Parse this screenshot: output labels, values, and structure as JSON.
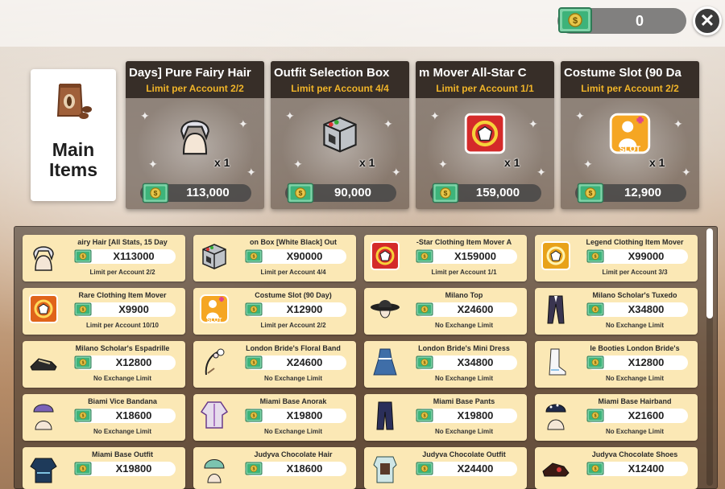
{
  "currency": {
    "amount": "0",
    "icon": "cash-icon"
  },
  "close": {
    "label": "✕"
  },
  "main_tab": {
    "label_line1": "Main",
    "label_line2": "Items",
    "icon": "coffee-bag-icon"
  },
  "featured": [
    {
      "title": "Days] Pure Fairy Hair",
      "limit": "Limit per Account 2/2",
      "qty": "x 1",
      "price": "113,000",
      "icon": "hair-icon"
    },
    {
      "title": "Outfit Selection Box",
      "limit": "Limit per Account 4/4",
      "qty": "x 1",
      "price": "90,000",
      "icon": "box-icon"
    },
    {
      "title": "m Mover      All-Star C",
      "limit": "Limit per Account 1/1",
      "qty": "x 1",
      "price": "159,000",
      "icon": "mover-icon"
    },
    {
      "title": "Costume Slot (90 Da",
      "limit": "Limit per Account 2/2",
      "qty": "x 1",
      "price": "12,900",
      "icon": "slot-icon"
    }
  ],
  "grid": [
    {
      "name": "airy Hair        [All Stats, 15 Day",
      "price": "X113000",
      "limit": "Limit per Account 2/2",
      "icon": "hair-icon"
    },
    {
      "name": "on Box        [White Black] Out",
      "price": "X90000",
      "limit": "Limit per Account 4/4",
      "icon": "box-icon"
    },
    {
      "name": "-Star Clothing Item Mover       A",
      "price": "X159000",
      "limit": "Limit per Account 1/1",
      "icon": "mover-icon"
    },
    {
      "name": "Legend Clothing Item Mover",
      "price": "X99000",
      "limit": "Limit per Account 3/3",
      "icon": "legend-mover-icon"
    },
    {
      "name": "Rare Clothing Item Mover",
      "price": "X9900",
      "limit": "Limit per Account 10/10",
      "icon": "rare-mover-icon"
    },
    {
      "name": "Costume Slot (90 Day)",
      "price": "X12900",
      "limit": "Limit per Account 2/2",
      "icon": "slot-icon"
    },
    {
      "name": "Milano Top",
      "price": "X24600",
      "limit": "No Exchange Limit",
      "icon": "hat-icon"
    },
    {
      "name": "Milano Scholar's Tuxedo",
      "price": "X34800",
      "limit": "No Exchange Limit",
      "icon": "tuxedo-icon"
    },
    {
      "name": "Milano Scholar's Espadrille",
      "price": "X12800",
      "limit": "No Exchange Limit",
      "icon": "shoe-icon"
    },
    {
      "name": "London Bride's Floral Band",
      "price": "X24600",
      "limit": "No Exchange Limit",
      "icon": "floral-band-icon"
    },
    {
      "name": "London Bride's Mini Dress",
      "price": "X34800",
      "limit": "No Exchange Limit",
      "icon": "dress-icon"
    },
    {
      "name": "le Booties        London Bride's",
      "price": "X12800",
      "limit": "No Exchange Limit",
      "icon": "booties-icon"
    },
    {
      "name": "Biami Vice Bandana",
      "price": "X18600",
      "limit": "No Exchange Limit",
      "icon": "bandana-icon"
    },
    {
      "name": "Miami Base Anorak",
      "price": "X19800",
      "limit": "No Exchange Limit",
      "icon": "anorak-icon"
    },
    {
      "name": "Miami Base Pants",
      "price": "X19800",
      "limit": "No Exchange Limit",
      "icon": "pants-icon"
    },
    {
      "name": "Miami Base Hairband",
      "price": "X21600",
      "limit": "No Exchange Limit",
      "icon": "hairband-icon"
    },
    {
      "name": "Miami Base Outfit",
      "price": "X19800",
      "limit": "",
      "icon": "outfit-icon"
    },
    {
      "name": "Judyva Chocolate Hair",
      "price": "X18600",
      "limit": "",
      "icon": "choco-hair-icon"
    },
    {
      "name": "Judyva Chocolate Outfit",
      "price": "X24400",
      "limit": "",
      "icon": "choco-outfit-icon"
    },
    {
      "name": "Judyva Chocolate Shoes",
      "price": "X12400",
      "limit": "",
      "icon": "choco-shoes-icon"
    }
  ],
  "colors": {
    "limit_gold": "#f0b429",
    "cell_bg": "#fbe8b5",
    "cash_green": "#2fa86a"
  }
}
